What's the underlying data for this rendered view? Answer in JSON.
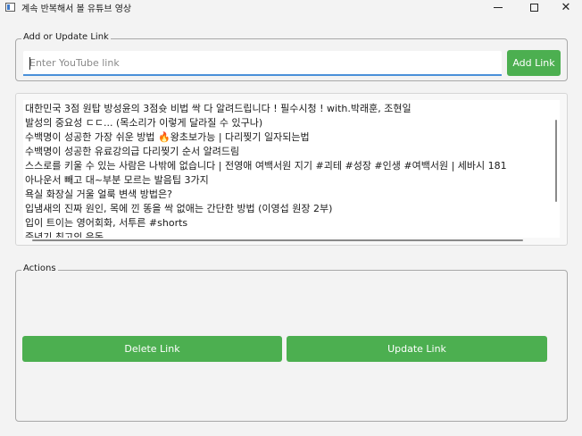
{
  "window": {
    "title": "계속 반복해서 볼 유튜브 영상",
    "minimize_glyph": "–",
    "close_glyph": "✕"
  },
  "icons": {
    "app": "app-icon",
    "minimize": "minimize-icon",
    "maximize": "maximize-icon",
    "close": "close-icon"
  },
  "add_group": {
    "label": "Add or Update Link",
    "input_value": "",
    "input_placeholder": "Enter YouTube link",
    "add_button": "Add Link"
  },
  "links": [
    "대한민국 3점 원탑 방성윤의 3점슛 비법 싹 다 알려드립니다 ! 필수시청 ! with.박래훈, 조현일",
    "발성의 중요성 ㄷㄷ... (목소리가 이렇게 달라질 수 있구나)",
    "수백명이 성공한 가장 쉬운 방법 🔥왕초보가능 | 다리찢기 일자되는법",
    "수백명이 성공한 유료강의급 다리찢기 순서 알려드림",
    "스스로를 키울 수 있는 사람은 나밖에 없습니다 | 전영애 여백서원 지기 #괴테  #성장 #인생 #여백서원 | 세바시 181",
    "아나운서 빼고 대~부분 모르는 발음팁 3가지",
    "욕실 화장실 거울 얼룩 변색 방법은?",
    "입냄새의 진짜 원인, 목에 낀 똥을 싹 없애는 간단한 방법 (이영섭 원장 2부)",
    "입이 트이는 영어회화, 서투른 #shorts",
    "중년기 최고의 운동"
  ],
  "actions_group": {
    "label": "Actions",
    "delete_button": "Delete Link",
    "update_button": "Update Link"
  },
  "colors": {
    "accent_green": "#4caf50",
    "input_underline": "#4a90d9",
    "background": "#f3f3f3"
  }
}
